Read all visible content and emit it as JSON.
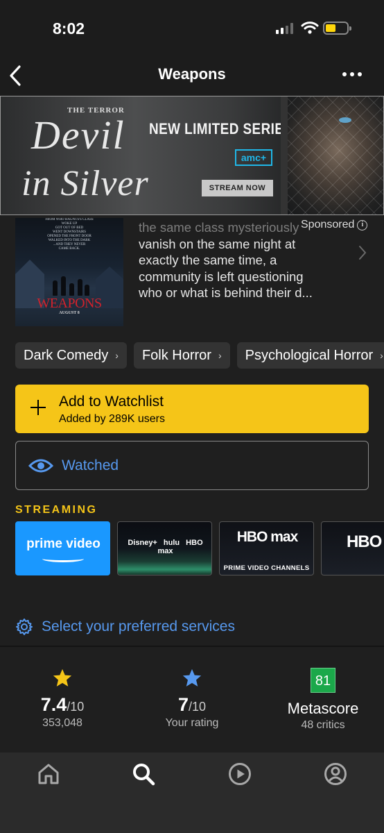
{
  "status_bar": {
    "time": "8:02"
  },
  "nav": {
    "title": "Weapons"
  },
  "ad": {
    "kicker": "THE TERROR",
    "title_line1": "Devil",
    "title_line2": "in Silver",
    "headline": "NEW LIMITED SERIES",
    "network": "amc+",
    "cta": "STREAM NOW",
    "sponsored_label": "Sponsored"
  },
  "poster": {
    "tagline": [
      "FROM WHO HAUNTS'S CLASS",
      "WOKE UP",
      "GOT OUT OF BED",
      "WENT DOWNSTAIRS",
      "OPENED THE FRONT DOOR",
      "WALKED INTO THE DARK",
      "...AND THEY NEVER",
      "CAME BACK."
    ],
    "title": "WEAPONS",
    "release": "AUGUST 8"
  },
  "plot": {
    "lines": [
      "the same class mysteriously",
      "vanish on the same night at",
      "exactly the same time, a",
      "community is left questioning",
      "who or what is behind their d..."
    ]
  },
  "genres": [
    "Dark Comedy",
    "Folk Horror",
    "Psychological Horror"
  ],
  "watchlist": {
    "label": "Add to Watchlist",
    "sub": "Added by 289K users"
  },
  "watched": {
    "label": "Watched"
  },
  "streaming": {
    "label": "STREAMING",
    "tiles": [
      {
        "name": "prime video"
      },
      {
        "name": "Disney+ hulu HBO max"
      },
      {
        "name": "HBO max",
        "caption": "PRIME VIDEO CHANNELS"
      },
      {
        "name": "HBO max"
      }
    ]
  },
  "preferences": {
    "label": "Select your preferred services"
  },
  "ratings": {
    "imdb": {
      "score": "7.4",
      "scale": "/10",
      "votes": "353,048"
    },
    "user": {
      "score": "7",
      "scale": "/10",
      "label": "Your rating"
    },
    "metascore": {
      "score": "81",
      "label": "Metascore",
      "critics": "48 critics"
    }
  },
  "colors": {
    "accent": "#f5c518",
    "link": "#5799ef",
    "meta_green": "#1ba84a"
  },
  "tabs": [
    "home-icon",
    "search-icon",
    "play-icon",
    "profile-icon"
  ]
}
